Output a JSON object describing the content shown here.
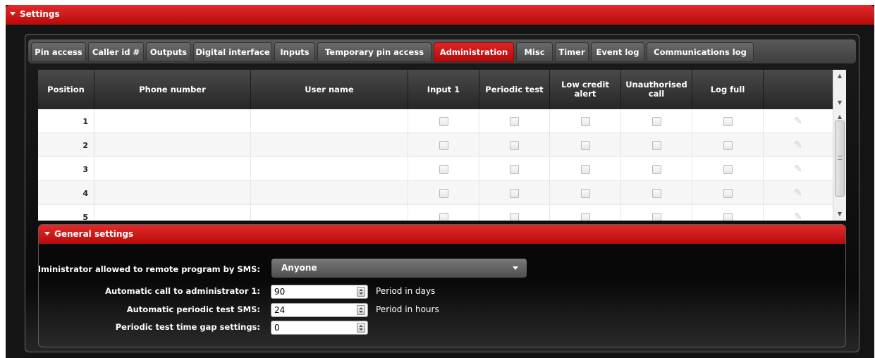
{
  "window": {
    "title": "Settings"
  },
  "tabs": [
    {
      "label": "Pin access"
    },
    {
      "label": "Caller id #"
    },
    {
      "label": "Outputs"
    },
    {
      "label": "Digital interface"
    },
    {
      "label": "Inputs"
    },
    {
      "label": "Temporary pin access"
    },
    {
      "label": "Administration",
      "active": true
    },
    {
      "label": "Misc"
    },
    {
      "label": "Timer"
    },
    {
      "label": "Event log"
    },
    {
      "label": "Communications log"
    }
  ],
  "table": {
    "columns": [
      "Position",
      "Phone number",
      "User name",
      "Input 1",
      "Periodic test",
      "Low credit alert",
      "Unauthorised call",
      "Log full"
    ],
    "rows": [
      {
        "position": "1",
        "phone": "",
        "user": "",
        "input1": false,
        "periodic": false,
        "lowcredit": false,
        "unauth": false,
        "logfull": false
      },
      {
        "position": "2",
        "phone": "",
        "user": "",
        "input1": false,
        "periodic": false,
        "lowcredit": false,
        "unauth": false,
        "logfull": false
      },
      {
        "position": "3",
        "phone": "",
        "user": "",
        "input1": false,
        "periodic": false,
        "lowcredit": false,
        "unauth": false,
        "logfull": false
      },
      {
        "position": "4",
        "phone": "",
        "user": "",
        "input1": false,
        "periodic": false,
        "lowcredit": false,
        "unauth": false,
        "logfull": false
      },
      {
        "position": "5",
        "phone": "",
        "user": "",
        "input1": false,
        "periodic": false,
        "lowcredit": false,
        "unauth": false,
        "logfull": false
      }
    ]
  },
  "general": {
    "title": "General settings",
    "sms_label": "Administrator allowed to remote program by SMS:",
    "sms_value": "Anyone",
    "call_label": "Automatic call to administrator 1:",
    "call_value": "90",
    "call_unit": "Period in days",
    "test_label": "Automatic periodic test SMS:",
    "test_value": "24",
    "test_unit": "Period in hours",
    "gap_label": "Periodic test time gap settings:",
    "gap_value": "0"
  },
  "icons": {
    "collapse": "triangle-down-icon",
    "edit": "pencil-icon",
    "dropdown": "chevron-down-icon"
  },
  "colors": {
    "accent_red": "#d01515",
    "header_dark": "#2e2e2e",
    "background": "#141414"
  }
}
